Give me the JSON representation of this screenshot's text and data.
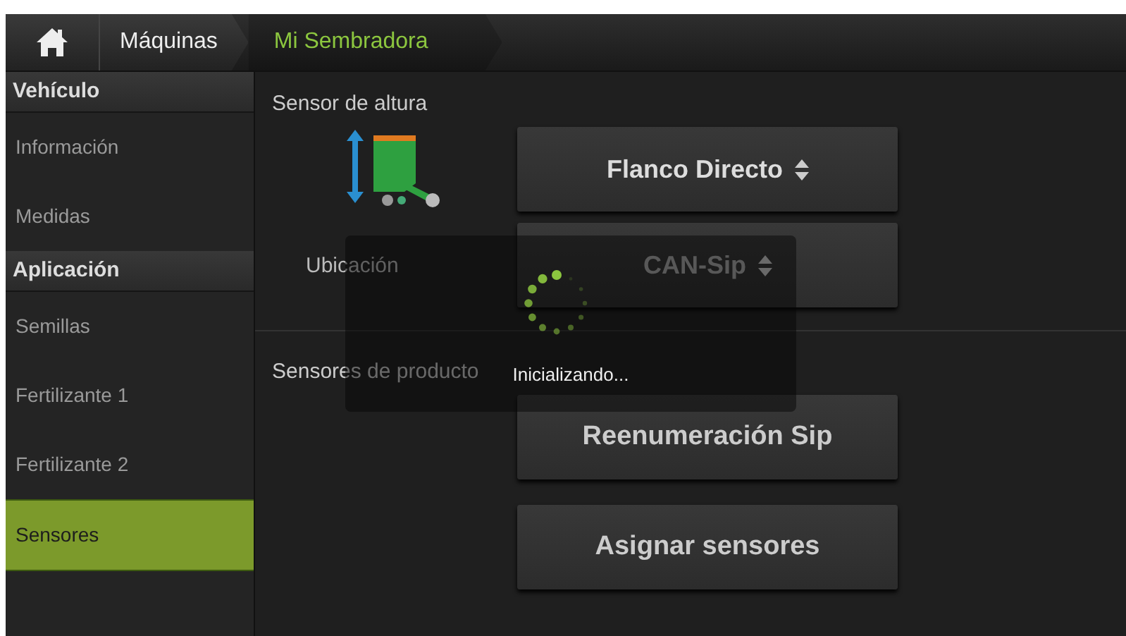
{
  "breadcrumb": [
    {
      "label": "Máquinas",
      "selected": false
    },
    {
      "label": "Mi Sembradora",
      "selected": true
    }
  ],
  "sidebar": {
    "sections": [
      {
        "title": "Vehículo",
        "items": [
          {
            "label": "Información",
            "selected": false
          },
          {
            "label": "Medidas",
            "selected": false
          }
        ]
      },
      {
        "title": "Aplicación",
        "items": [
          {
            "label": "Semillas",
            "selected": false
          },
          {
            "label": "Fertilizante 1",
            "selected": false
          },
          {
            "label": "Fertilizante 2",
            "selected": false
          },
          {
            "label": "Sensores",
            "selected": true
          }
        ]
      }
    ]
  },
  "height_sensor": {
    "title": "Sensor de altura",
    "mode": "Flanco Directo",
    "location_label": "Ubicación",
    "location": "CAN-Sip"
  },
  "product_sensors": {
    "title": "Sensores de producto",
    "buttons": [
      "Reenumeración Sip",
      "Asignar sensores"
    ]
  },
  "loading": {
    "text": "Inicializando..."
  }
}
